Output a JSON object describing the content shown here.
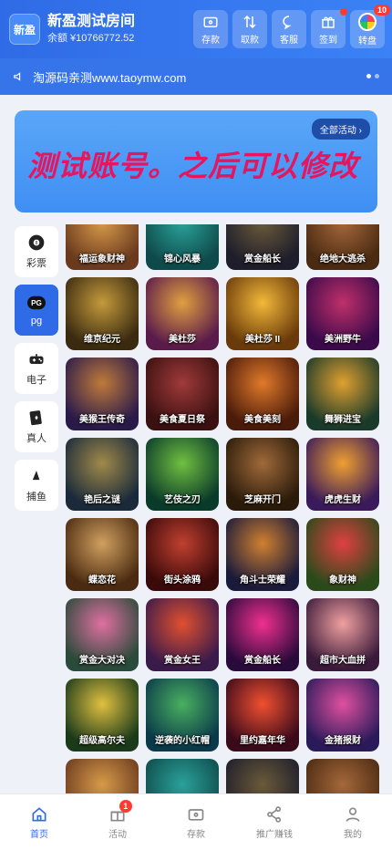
{
  "header": {
    "logo_text": "新盈",
    "room_name": "新盈测试房间",
    "balance": "余额 ¥10766772.52",
    "buttons": [
      {
        "label": "存款",
        "icon": "wallet-icon"
      },
      {
        "label": "取款",
        "icon": "transfer-arrows-icon"
      },
      {
        "label": "客服",
        "icon": "chat-icon"
      },
      {
        "label": "签到",
        "icon": "gift-icon"
      },
      {
        "label": "转盘",
        "icon": "wheel-icon",
        "badge": "10"
      }
    ]
  },
  "notice": {
    "text": "淘源码亲测www.taoymw.com",
    "icon": "speaker-icon"
  },
  "banner": {
    "text": "测试账号。之后可以修改",
    "all_activities": "全部活动"
  },
  "sidebar": {
    "items": [
      {
        "label": "彩票",
        "icon": "lottery-ball-icon"
      },
      {
        "label": "pg",
        "icon": "pg-logo-icon",
        "active": true
      },
      {
        "label": "电子",
        "icon": "gamepad-icon"
      },
      {
        "label": "真人",
        "icon": "cards-icon"
      },
      {
        "label": "捕鱼",
        "icon": "fish-icon"
      }
    ]
  },
  "games": {
    "partial_top": [
      "福运象财神",
      "锦心风暴",
      "赏金船长",
      "绝地大逃杀"
    ],
    "rows": [
      [
        "维京纪元",
        "美杜莎",
        "美杜莎 II",
        "美洲野牛"
      ],
      [
        "美猴王传奇",
        "美食夏日祭",
        "美食美刻",
        "舞狮进宝"
      ],
      [
        "艳后之谜",
        "艺伎之刃",
        "芝麻开门",
        "虎虎生财"
      ],
      [
        "蝶恋花",
        "街头涂鸦",
        "角斗士荣耀",
        "象财神"
      ],
      [
        "赏金大对决",
        "赏金女王",
        "赏金船长",
        "超市大血拼"
      ],
      [
        "超级高尔夫",
        "逆袭的小红帽",
        "里约嘉年华",
        "金猪报财"
      ],
      [
        "",
        "",
        "",
        ""
      ]
    ]
  },
  "bottom_nav": {
    "items": [
      {
        "label": "首页",
        "icon": "home-icon",
        "active": true
      },
      {
        "label": "活动",
        "icon": "gift-icon",
        "badge": "1"
      },
      {
        "label": "存款",
        "icon": "wallet-icon"
      },
      {
        "label": "推广赚钱",
        "icon": "share-icon"
      },
      {
        "label": "我的",
        "icon": "user-icon"
      }
    ]
  }
}
